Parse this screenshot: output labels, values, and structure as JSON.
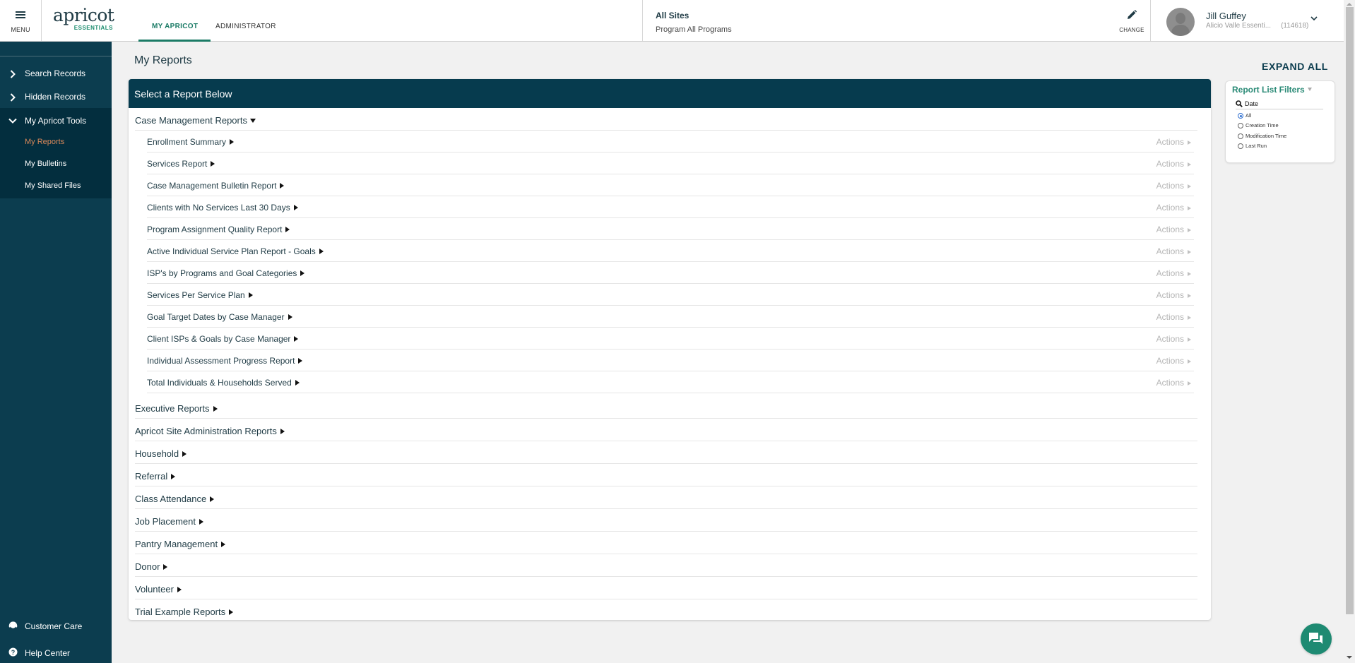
{
  "header": {
    "menu_label": "MENU",
    "logo_word": "apricot",
    "logo_sub": "ESSENTIALS",
    "tabs": [
      {
        "label": "MY APRICOT",
        "active": true
      },
      {
        "label": "ADMINISTRATOR",
        "active": false
      }
    ],
    "site": {
      "title": "All Sites",
      "program": "Program All Programs"
    },
    "change_label": "CHANGE",
    "user": {
      "name": "Jill Guffey",
      "org": "Alicio Valle Essenti...",
      "id": "(114618)"
    }
  },
  "sidebar": {
    "items": [
      {
        "label": "Search Records",
        "expanded": false
      },
      {
        "label": "Hidden Records",
        "expanded": false
      },
      {
        "label": "My Apricot Tools",
        "expanded": true
      }
    ],
    "sub_items": [
      {
        "label": "My Reports",
        "active": true
      },
      {
        "label": "My Bulletins",
        "active": false
      },
      {
        "label": "My Shared Files",
        "active": false
      }
    ],
    "footer": [
      {
        "label": "Customer Care",
        "icon": "headset-icon"
      },
      {
        "label": "Help Center",
        "icon": "help-icon"
      }
    ]
  },
  "main": {
    "page_title": "My Reports",
    "panel_title": "Select a Report Below",
    "expand_all_label": "EXPAND ALL",
    "actions_label": "Actions",
    "expanded_category": {
      "label": "Case Management Reports",
      "reports": [
        "Enrollment Summary",
        "Services Report",
        "Case Management Bulletin Report",
        "Clients with No Services Last 30 Days",
        "Program Assignment Quality Report",
        "Active Individual Service Plan Report - Goals",
        "ISP's by Programs and Goal Categories",
        "Services Per Service Plan",
        "Goal Target Dates by Case Manager",
        "Client ISPs & Goals by Case Manager",
        "Individual Assessment Progress Report",
        "Total Individuals & Households Served"
      ]
    },
    "collapsed_categories": [
      "Executive Reports",
      "Apricot Site Administration Reports",
      "Household",
      "Referral",
      "Class Attendance",
      "Job Placement",
      "Pantry Management",
      "Donor",
      "Volunteer",
      "Trial Example Reports"
    ]
  },
  "filters": {
    "title": "Report List Filters",
    "section_label": "Date",
    "options": [
      {
        "label": "All",
        "selected": true
      },
      {
        "label": "Creation Time",
        "selected": false
      },
      {
        "label": "Modification Time",
        "selected": false
      },
      {
        "label": "Last Run",
        "selected": false
      }
    ]
  },
  "colors": {
    "sidebar_bg": "#0c3d4f",
    "panel_header_bg": "#063b4e",
    "accent_green": "#1b7b66",
    "active_nav_orange": "#d9885a",
    "chat_button": "#1e8a72"
  }
}
